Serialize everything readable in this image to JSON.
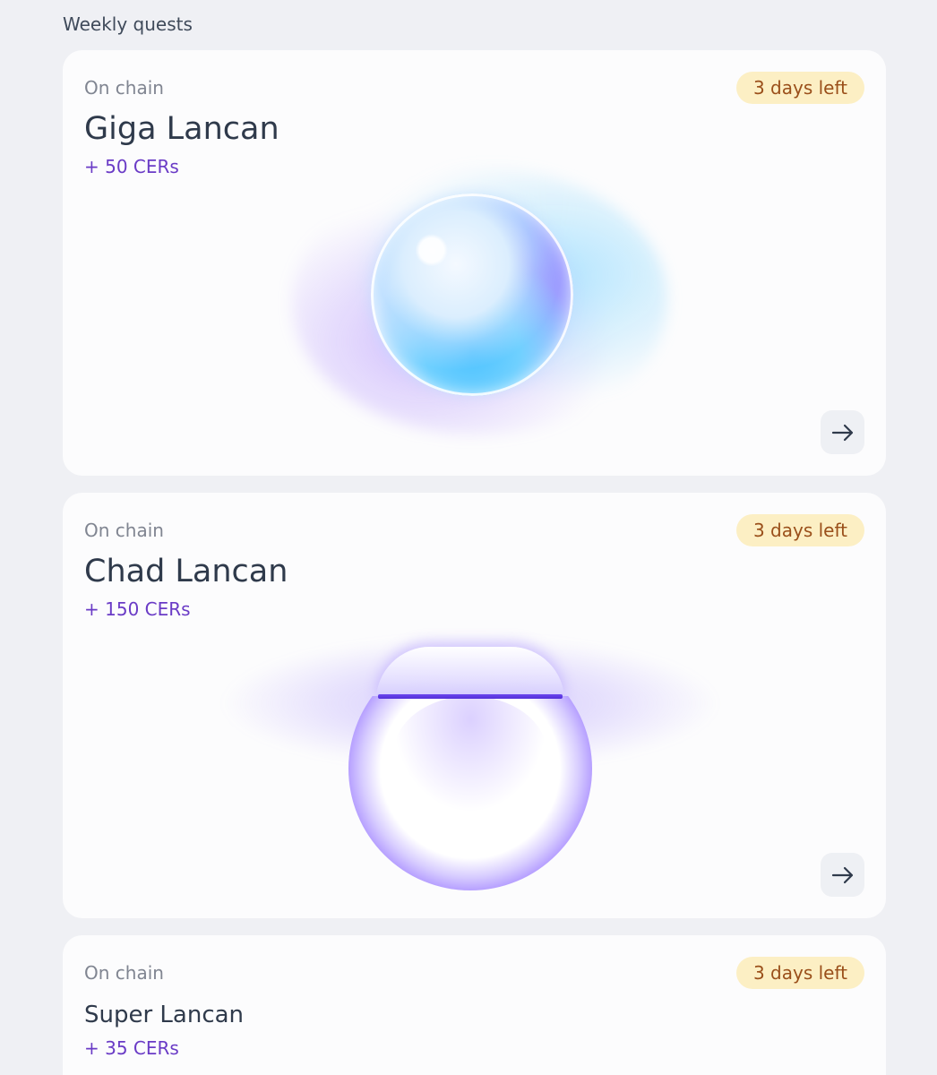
{
  "section": {
    "title": "Weekly quests"
  },
  "quests": [
    {
      "category": "On chain",
      "badge": "3 days left",
      "title": "Giga Lancan",
      "reward": "+ 50 CERs"
    },
    {
      "category": "On chain",
      "badge": "3 days left",
      "title": "Chad Lancan",
      "reward": "+ 150 CERs"
    },
    {
      "category": "On chain",
      "badge": "3 days left",
      "title": "Super Lancan",
      "reward": "+ 35 CERs"
    }
  ],
  "icons": {
    "arrow": "arrow-right-icon"
  },
  "colors": {
    "page_background": "#eff0f4",
    "card_background": "#fcfcfd",
    "badge_background": "#fcefc4",
    "badge_text": "#9a4f1a",
    "reward_text": "#6a3bc6"
  }
}
